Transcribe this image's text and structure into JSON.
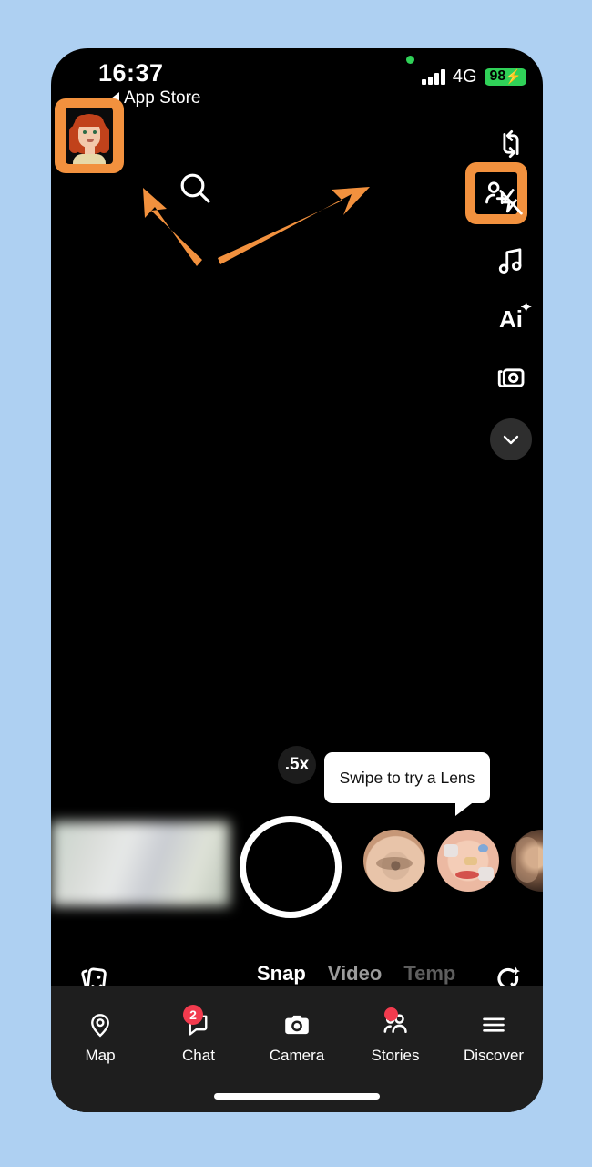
{
  "background_color": "#aed0f2",
  "accent_highlight_color": "#f2913e",
  "status_bar": {
    "time": "16:37",
    "back_link": "App Store",
    "network": "4G",
    "battery_level": "98",
    "battery_charging_glyph": "⚡",
    "signal_icon": "cellular-signal-icon",
    "recording_dot_icon": "green-privacy-dot-icon"
  },
  "top_controls": {
    "profile_avatar_name": "bitmoji-avatar",
    "search_icon": "search-icon",
    "add_friend_icon": "add-friend-icon"
  },
  "right_rail": {
    "items": [
      {
        "icon": "camera-flip-icon",
        "label": "Flip camera"
      },
      {
        "icon": "flash-off-icon",
        "label": "Flash off"
      },
      {
        "icon": "music-note-icon",
        "label": "Music"
      },
      {
        "icon": "ai-sparkle-icon",
        "label": "Ai"
      },
      {
        "icon": "camera-roll-icon",
        "label": "Camera roll"
      },
      {
        "icon": "chevron-down-icon",
        "label": "More"
      }
    ],
    "ai_label": "Ai",
    "ai_sparkle": "✦"
  },
  "camera": {
    "zoom_level": ".5x",
    "tooltip_text": "Swipe to try a Lens",
    "shutter_label": "shutter-button",
    "gallery_preview_label": "gallery-preview"
  },
  "lenses": [
    {
      "name": "lens-thumbnail-eye"
    },
    {
      "name": "lens-thumbnail-hello-kitty"
    },
    {
      "name": "lens-thumbnail-portrait"
    }
  ],
  "modes": [
    {
      "label": "Snap",
      "state": "active"
    },
    {
      "label": "Video",
      "state": "inactive"
    },
    {
      "label": "Temp",
      "state": "cut-off"
    }
  ],
  "bottom_icons": {
    "memories": "memories-icon",
    "lens_explore": "lens-explore-icon"
  },
  "nav_bar": {
    "items": [
      {
        "label": "Map",
        "icon": "map-pin-icon",
        "badge": "",
        "dot": false
      },
      {
        "label": "Chat",
        "icon": "chat-bubble-icon",
        "badge": "2",
        "dot": false
      },
      {
        "label": "Camera",
        "icon": "camera-icon",
        "badge": "",
        "dot": false
      },
      {
        "label": "Stories",
        "icon": "stories-people-icon",
        "badge": "",
        "dot": true
      },
      {
        "label": "Discover",
        "icon": "hamburger-menu-icon",
        "badge": "",
        "dot": false
      }
    ],
    "badge_color": "#f23b4e"
  },
  "annotations": {
    "arrow_color": "#f2913e",
    "arrow_left": "arrow-pointing-to-profile-avatar",
    "arrow_right": "arrow-pointing-to-add-friend-button"
  },
  "home_indicator": "home-indicator-bar"
}
